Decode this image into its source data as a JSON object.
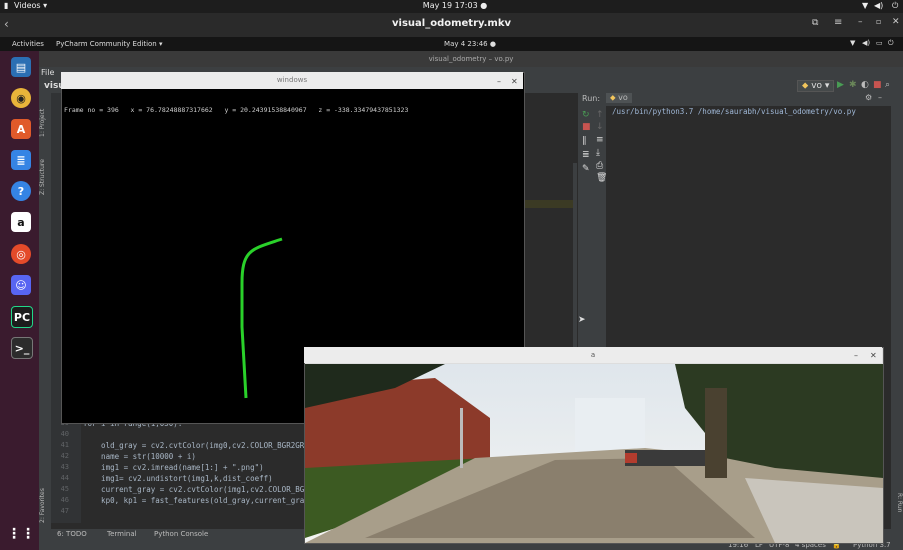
{
  "player": {
    "menu_label": "Videos ▾",
    "date_time": "May 19  17:03 ●",
    "file_title": "visual_odometry.mkv"
  },
  "ubuntu": {
    "activities": "Activities",
    "app_menu": "PyCharm Community Edition ▾",
    "clock": "May 4  23:46 ●"
  },
  "pycharm": {
    "window_title": "visual_odometry – vo.py",
    "menu_file": "File",
    "project_label": "visu",
    "run_config": "vo",
    "left_tabs": [
      "1: Project",
      "Z: Structure",
      "2: Favorites"
    ],
    "run_label": "Run:",
    "run_tab": "vo",
    "run_output": "/usr/bin/python3.7 /home/saurabh/visual_odometry/vo.py",
    "right_tab": "R: Run",
    "code_lines": [
      {
        "n": "39",
        "text": "for i in range(1,050):"
      },
      {
        "n": "40",
        "text": ""
      },
      {
        "n": "41",
        "text": "    old_gray = cv2.cvtColor(img0,cv2.COLOR_BGR2GRAY)"
      },
      {
        "n": "42",
        "text": "    name = str(10000 + i)"
      },
      {
        "n": "43",
        "text": "    img1 = cv2.imread(name[1:] + \".png\")"
      },
      {
        "n": "44",
        "text": "    img1= cv2.undistort(img1,k,dist_coeff)"
      },
      {
        "n": "45",
        "text": "    current_gray = cv2.cvtColor(img1,cv2.COLOR_BGR2GRAY)"
      },
      {
        "n": "46",
        "text": "    kp0, kp1 = fast_features(old_gray,current_gray)"
      },
      {
        "n": "47",
        "text": ""
      }
    ],
    "bottom_tabs": [
      "6: TODO",
      "Terminal",
      "Python Console"
    ],
    "status": {
      "position": "19:16",
      "line_sep": "LF",
      "encoding": "UTF-8",
      "indent": "4 spaces",
      "interpreter": "Python 3.7"
    }
  },
  "cv_window": {
    "title": "windows",
    "frame_text": "Frame no = 396   x = 76.78248887317662   y = 20.24391538840967   z = -338.33479437851323"
  },
  "image_window": {
    "title": "a"
  }
}
